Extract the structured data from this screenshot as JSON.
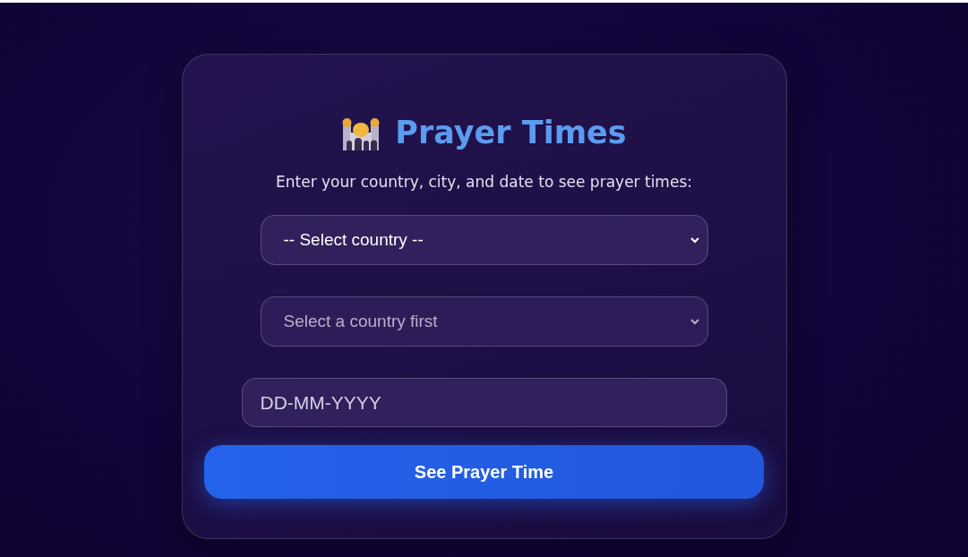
{
  "card": {
    "title": "Prayer Times",
    "subtitle": "Enter your country, city, and date to see prayer times:"
  },
  "country_select": {
    "value": "-- Select country --",
    "disabled": false
  },
  "city_select": {
    "value": "Select a country first",
    "disabled": true
  },
  "date_field": {
    "placeholder": "DD-MM-YYYY"
  },
  "submit_button": {
    "label": "See Prayer Time"
  }
}
